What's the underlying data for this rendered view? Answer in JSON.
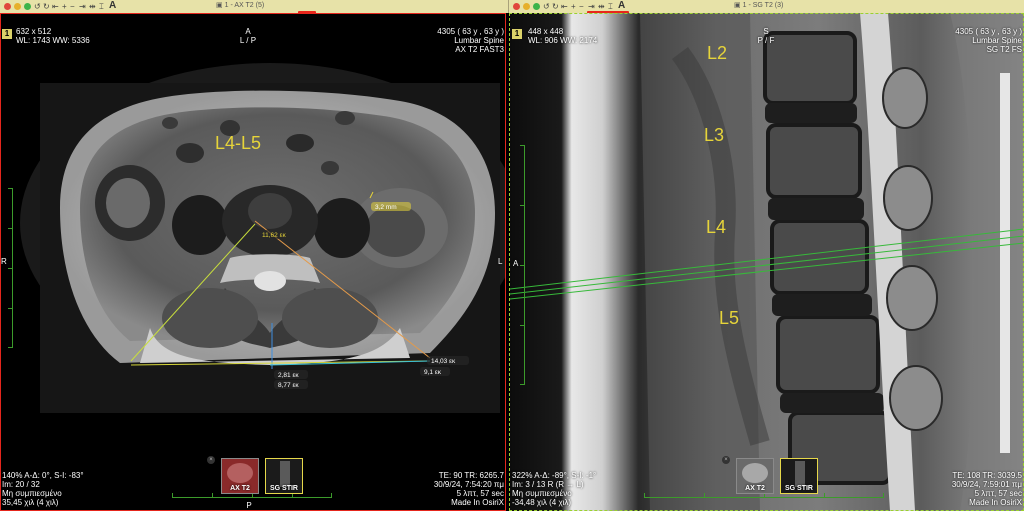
{
  "toolbar": {
    "left_title": "1 - AX T2 (5)",
    "right_title": "1 - SG T2 (3)",
    "tool_icons": [
      "rotate-ccw-icon",
      "rotate-cw-icon",
      "first-icon",
      "plus-icon",
      "minus-icon",
      "last-icon",
      "pipe-icon",
      "bracket-icon",
      "ruler-icon",
      "text-tool-icon"
    ]
  },
  "left_viewer": {
    "badge": "1",
    "top_left": [
      "632 x 512",
      "WL: 1743 WW: 5336"
    ],
    "top_center": [
      "A",
      "L / P"
    ],
    "top_right": [
      "4305 ( 63 y , 63 y )",
      "Lumbar Spine",
      "AX T2 FAST3"
    ],
    "side_left": "R",
    "side_right": "L",
    "bottom_center": "P",
    "bottom_left": [
      "140% A-Δ: 0°, S-I: -83°",
      "Im: 20 / 32",
      "Μη συμπιεσμένο",
      "35,45 χιλ (4 χιλ)"
    ],
    "bottom_right": [
      "TE: 90 TR: 6265.7",
      "30/9/24, 7:54:20 πμ",
      "5 λπτ, 57 sec",
      "Made In OsiriX"
    ],
    "level_label": "L4-L5",
    "measurements": {
      "m1": "11,62 εκ",
      "m2": "3,2 mm",
      "m3": "14,03 εκ",
      "m4": "9,1 εκ",
      "m5": "2,81 εκ",
      "m6": "8,77 εκ"
    },
    "thumbs": [
      {
        "label": "AX T2",
        "selected": false
      },
      {
        "label": "SG STIR",
        "selected": true
      }
    ]
  },
  "right_viewer": {
    "badge": "1",
    "top_left": [
      "448 x 448",
      "WL: 906 WW: 2174"
    ],
    "top_center": [
      "S",
      "P / F"
    ],
    "top_right": [
      "4305 ( 63 y , 63 y )",
      "Lumbar Spine",
      "SG T2 FS"
    ],
    "side_left": "A",
    "bottom_left": [
      "322% A-Δ: -89°, S-I: -1°",
      "Im: 3 / 13  R (R → L)",
      "Μη συμπιεσμένο",
      "-34,48 χιλ (4 χιλ)"
    ],
    "bottom_right": [
      "TE: 108 TR: 3039.5",
      "30/9/24, 7:59:01 πμ",
      "5 λπτ, 57 sec",
      "Made In OsiriX"
    ],
    "vertebra_labels": [
      "L2",
      "L3",
      "L4",
      "L5"
    ],
    "thumbs": [
      {
        "label": "AX T2",
        "selected": false
      },
      {
        "label": "SG STIR",
        "selected": true
      }
    ]
  },
  "colors": {
    "titlebar": "#e7e2a8",
    "active_border": "#e5261d",
    "inactive_border": "#9bd12e",
    "label_yellow": "#e6d43a",
    "ruler_green": "#3c9b2b"
  }
}
